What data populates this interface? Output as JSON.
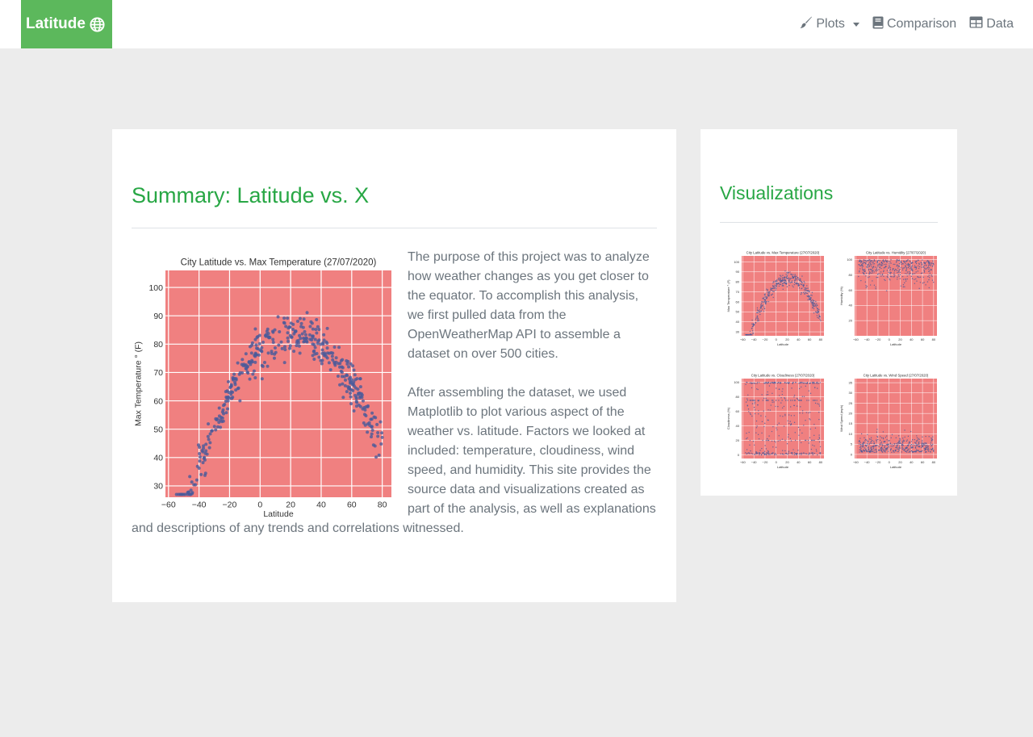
{
  "navbar": {
    "brand": "Latitude",
    "brand_icon": "globe-icon",
    "items": [
      {
        "label": "Plots",
        "icon": "paint-brush-icon",
        "has_caret": true
      },
      {
        "label": "Comparison",
        "icon": "book-icon"
      },
      {
        "label": "Data",
        "icon": "table-icon"
      }
    ]
  },
  "colors": {
    "brand": "#5cb85c",
    "heading": "#28a745",
    "plot_bg": "#f08080",
    "points": "#4a5a9a",
    "page_bg": "#ececec"
  },
  "summary": {
    "title": "Summary: Latitude vs. X",
    "paragraph1": "The purpose of this project was to analyze how weather changes as you get closer to the equator. To accomplish this analysis, we first pulled data from the OpenWeatherMap API to assemble a dataset on over 500 cities.",
    "paragraph2": "After assembling the dataset, we used Matplotlib to plot various aspect of the weather vs. latitude. Factors we looked at included: temperature, cloudiness, wind speed, and humidity. This site provides the source data and visualizations created as part of the analysis, as well as explanations and descriptions of any trends and correlations witnessed."
  },
  "visualizations": {
    "title": "Visualizations"
  },
  "chart_data": [
    {
      "type": "scatter",
      "title": "City Latitude vs. Max Temperature (27/07/2020)",
      "xlabel": "Latitude",
      "ylabel": "Max Temperature ° (F)",
      "xlim": [
        -62,
        86
      ],
      "ylim": [
        26,
        106
      ],
      "xticks": [
        -60,
        -40,
        -20,
        0,
        20,
        40,
        60,
        80
      ],
      "yticks": [
        30,
        40,
        50,
        60,
        70,
        80,
        90,
        100
      ],
      "grid": true,
      "shape": "arch",
      "x_range": [
        -55,
        80
      ],
      "peak_x": 22,
      "peak_y": 83
    },
    {
      "type": "scatter",
      "title": "City Latitude vs. Humidity (27/07/2020)",
      "xlabel": "Latitude",
      "ylabel": "Humidity (%)",
      "xlim": [
        -62,
        86
      ],
      "ylim": [
        0,
        105
      ],
      "xticks": [
        -60,
        -40,
        -20,
        0,
        20,
        40,
        60,
        80
      ],
      "yticks": [
        20,
        40,
        60,
        80,
        100
      ],
      "grid": true,
      "shape": "high-spread"
    },
    {
      "type": "scatter",
      "title": "City Latitude vs. Cloudiness (27/07/2020)",
      "xlabel": "Latitude",
      "ylabel": "Cloudiness (%)",
      "xlim": [
        -62,
        86
      ],
      "ylim": [
        -5,
        105
      ],
      "xticks": [
        -60,
        -40,
        -20,
        0,
        20,
        40,
        60,
        80
      ],
      "yticks": [
        0,
        20,
        40,
        60,
        80,
        100
      ],
      "grid": true,
      "shape": "uniform-with-bands"
    },
    {
      "type": "scatter",
      "title": "City Latitude vs. Wind Speed (27/07/2020)",
      "xlabel": "Latitude",
      "ylabel": "Wind Speed (mph)",
      "xlim": [
        -62,
        86
      ],
      "ylim": [
        -2,
        37
      ],
      "xticks": [
        -60,
        -40,
        -20,
        0,
        20,
        40,
        60,
        80
      ],
      "yticks": [
        0,
        5,
        10,
        15,
        20,
        25,
        30,
        35
      ],
      "grid": true,
      "shape": "low-skew"
    }
  ]
}
